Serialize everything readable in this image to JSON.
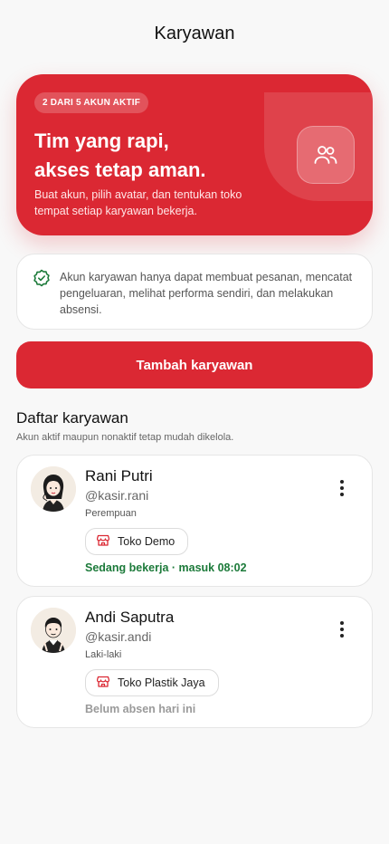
{
  "header": {
    "title": "Karyawan"
  },
  "hero": {
    "badge": "2 DARI 5 AKUN AKTIF",
    "title_line1": "Tim yang rapi,",
    "title_line2": "akses tetap aman.",
    "subtitle": "Buat akun, pilih avatar, dan tentukan toko tempat setiap karyawan bekerja.",
    "icon": "users-icon"
  },
  "info": {
    "icon": "check-badge-icon",
    "text": "Akun karyawan hanya dapat membuat pesanan, mencatat pengeluaran, melihat performa sendiri, dan melakukan absensi."
  },
  "actions": {
    "add_employee": "Tambah karyawan"
  },
  "list": {
    "title": "Daftar karyawan",
    "subtitle": "Akun aktif maupun nonaktif tetap mudah dikelola.",
    "employees": [
      {
        "name": "Rani Putri",
        "username": "@kasir.rani",
        "gender": "Perempuan",
        "store": "Toko Demo",
        "status": "Sedang bekerja · masuk 08:02",
        "status_color": "#1c7a3a"
      },
      {
        "name": "Andi Saputra",
        "username": "@kasir.andi",
        "gender": "Laki-laki",
        "store": "Toko Plastik Jaya",
        "status": "Belum absen hari ini",
        "status_color": "#9a9a9a"
      }
    ]
  },
  "colors": {
    "accent": "#db2833",
    "success": "#1c7a3a",
    "muted": "#9a9a9a"
  }
}
